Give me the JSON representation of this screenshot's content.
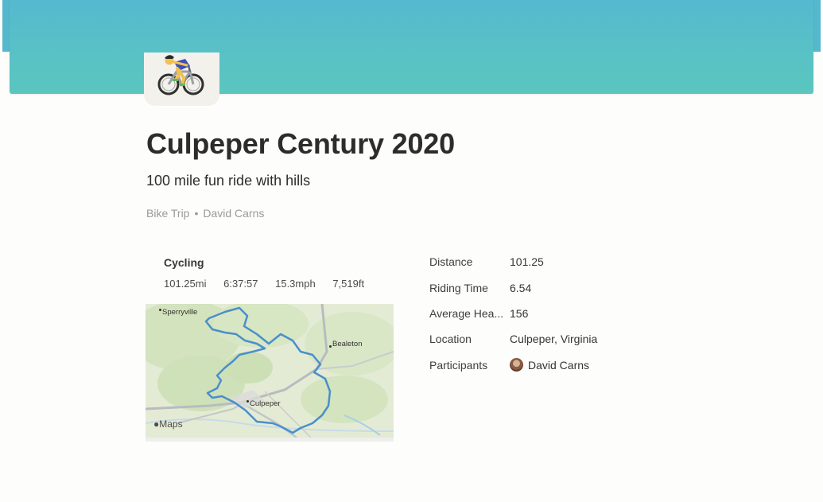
{
  "page": {
    "title": "Culpeper Century 2020",
    "subtitle": "100 mile fun ride with hills",
    "category": "Bike Trip",
    "author": "David Carns",
    "icon": "cyclist-emoji"
  },
  "workout": {
    "title": "Cycling",
    "stats": [
      "101.25mi",
      "6:37:57",
      "15.3mph",
      "7,519ft"
    ]
  },
  "map": {
    "brand": "Maps",
    "places": [
      "Sperryville",
      "Bealeton",
      "Culpeper"
    ]
  },
  "properties": [
    {
      "label": "Distance",
      "value": "101.25"
    },
    {
      "label": "Riding Time",
      "value": "6.54"
    },
    {
      "label": "Average Hea...",
      "value": "156"
    },
    {
      "label": "Location",
      "value": "Culpeper, Virginia"
    },
    {
      "label": "Participants",
      "value": "David Carns"
    }
  ],
  "colors": {
    "cover_top": "#55b9cf",
    "cover_bottom": "#5ac6be",
    "route": "#4a8fcb"
  }
}
